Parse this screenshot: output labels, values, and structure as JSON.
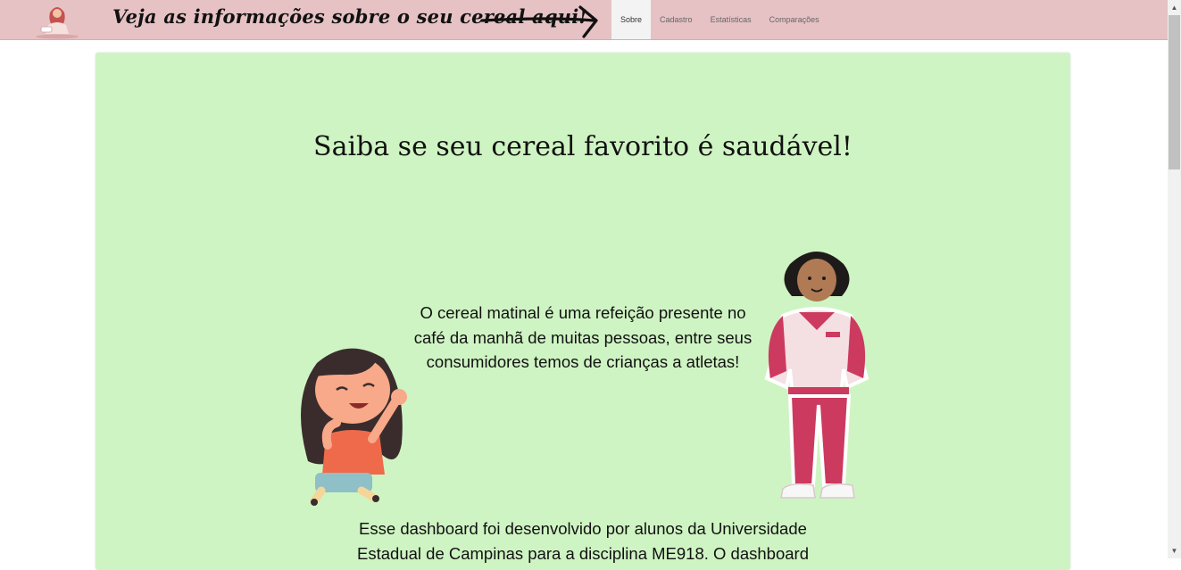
{
  "header": {
    "banner_text": "Veja as informações sobre o seu cereal aqui!",
    "nav": [
      {
        "label": "Sobre",
        "active": true
      },
      {
        "label": "Cadastro",
        "active": false
      },
      {
        "label": "Estatísticas",
        "active": false
      },
      {
        "label": "Comparações",
        "active": false
      }
    ]
  },
  "main": {
    "heading": "Saiba se seu cereal favorito é saudável!",
    "intro": "O cereal matinal é uma refeição presente no café da manhã de muitas pessoas, entre seus consumidores temos de crianças a atletas!",
    "footer_text": "Esse dashboard foi desenvolvido por alunos da Universidade Estadual de Campinas para a disciplina ME918. O dashboard"
  },
  "colors": {
    "header_bg": "#e6c2c4",
    "panel_bg": "#cff4c3",
    "accent": "#cc3a5f"
  },
  "icons": {
    "logo": "woman-eating-cereal-logo",
    "arrow": "arrow-right-icon",
    "girl": "laughing-girl-illustration",
    "athlete": "athlete-woman-illustration"
  }
}
